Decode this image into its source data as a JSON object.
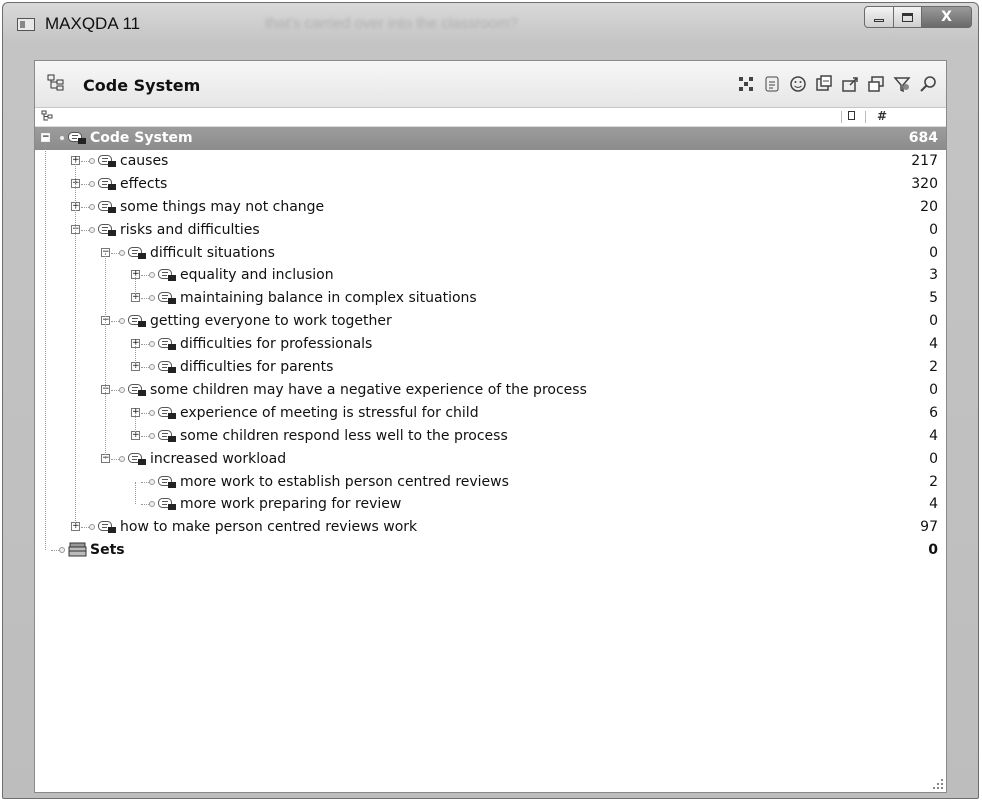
{
  "window": {
    "title": "MAXQDA 11",
    "background_text": "that's carried over into the classroom?",
    "minimize_label": "",
    "maximize_label": "",
    "close_label": "X"
  },
  "panel": {
    "title": "Code System",
    "toolbar": [
      {
        "name": "activate-all-icon"
      },
      {
        "name": "code-memo-icon"
      },
      {
        "name": "emoticode-icon"
      },
      {
        "name": "code-frequency-icon"
      },
      {
        "name": "export-icon"
      },
      {
        "name": "new-window-icon"
      },
      {
        "name": "filter-icon"
      },
      {
        "name": "search-icon"
      }
    ],
    "column_header": {
      "count_col": "#"
    }
  },
  "tree": [
    {
      "label": "Code System",
      "count": "684",
      "level": 0,
      "expander": "−",
      "root": true
    },
    {
      "label": "causes",
      "count": "217",
      "level": 1,
      "expander": "+"
    },
    {
      "label": "effects",
      "count": "320",
      "level": 1,
      "expander": "+"
    },
    {
      "label": "some things may not change",
      "count": "20",
      "level": 1,
      "expander": "+"
    },
    {
      "label": "risks and difficulties",
      "count": "0",
      "level": 1,
      "expander": "−"
    },
    {
      "label": "difficult situations",
      "count": "0",
      "level": 2,
      "expander": "−"
    },
    {
      "label": "equality and inclusion",
      "count": "3",
      "level": 3,
      "expander": "+"
    },
    {
      "label": "maintaining balance in complex situations",
      "count": "5",
      "level": 3,
      "expander": "+"
    },
    {
      "label": "getting everyone to work together",
      "count": "0",
      "level": 2,
      "expander": "−"
    },
    {
      "label": "difficulties for professionals",
      "count": "4",
      "level": 3,
      "expander": "+"
    },
    {
      "label": "difficulties for parents",
      "count": "2",
      "level": 3,
      "expander": "+"
    },
    {
      "label": "some children may have a negative experience of the process",
      "count": "0",
      "level": 2,
      "expander": "−"
    },
    {
      "label": "experience of meeting is stressful for child",
      "count": "6",
      "level": 3,
      "expander": "+"
    },
    {
      "label": "some children respond less well to the process",
      "count": "4",
      "level": 3,
      "expander": "+"
    },
    {
      "label": "increased workload",
      "count": "0",
      "level": 2,
      "expander": "−"
    },
    {
      "label": "more work to establish person centred reviews",
      "count": "2",
      "level": 3,
      "expander": ""
    },
    {
      "label": "more work preparing for review",
      "count": "4",
      "level": 3,
      "expander": ""
    },
    {
      "label": "how to make person centred reviews work",
      "count": "97",
      "level": 1,
      "expander": "+"
    },
    {
      "label": "Sets",
      "count": "0",
      "level": 0,
      "expander": "",
      "sets": true
    }
  ]
}
